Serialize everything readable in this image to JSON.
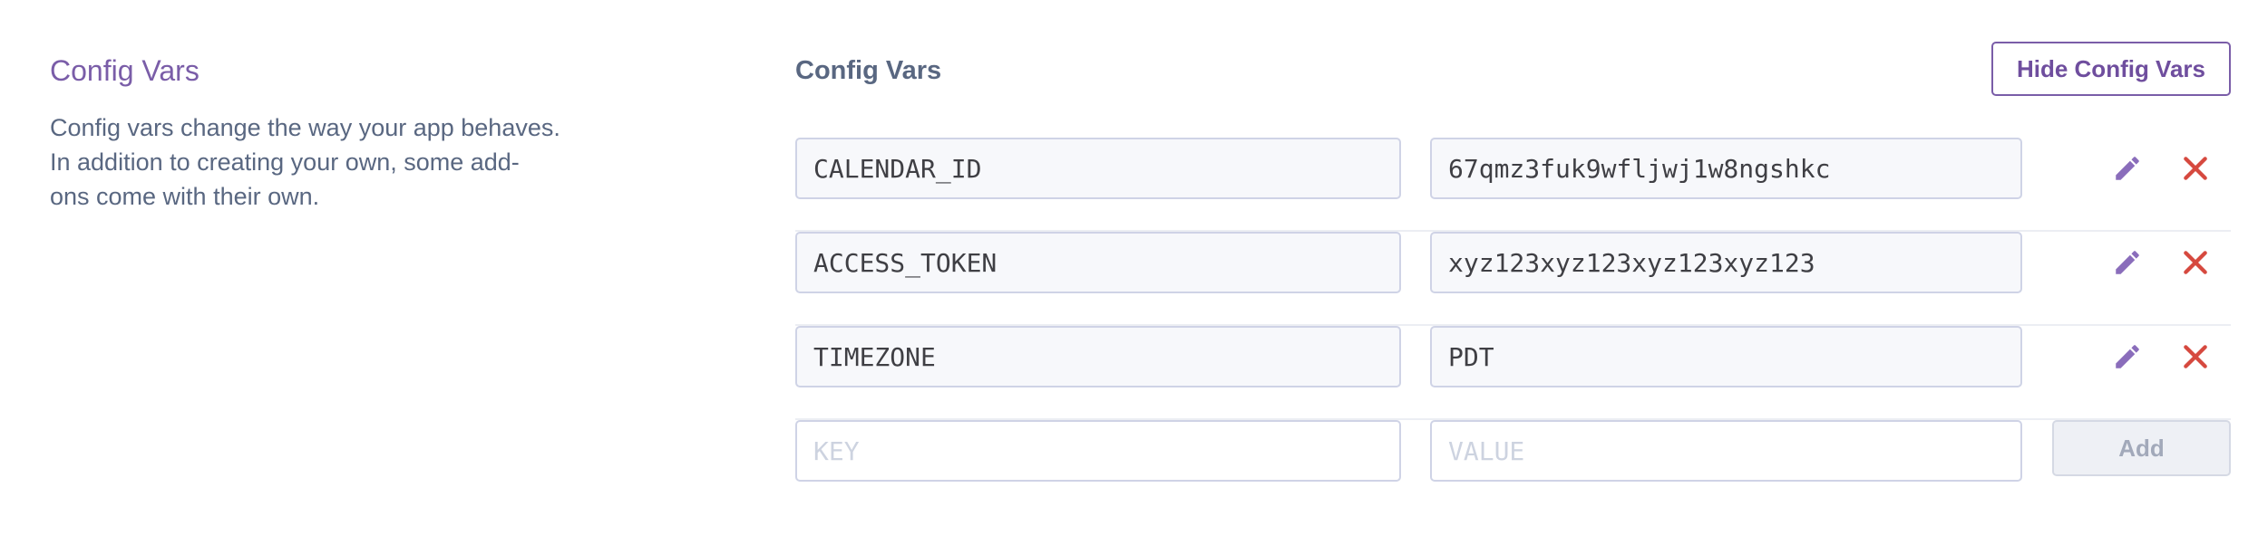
{
  "section": {
    "title": "Config Vars",
    "description_lines": [
      "Config vars change the way your app behaves.",
      "In addition to creating your own, some add-",
      "ons come with their own."
    ]
  },
  "panel": {
    "title": "Config Vars",
    "hide_button_label": "Hide Config Vars"
  },
  "vars": [
    {
      "key": "CALENDAR_ID",
      "value": "67qmz3fuk9wfljwj1w8ngshkc"
    },
    {
      "key": "ACCESS_TOKEN",
      "value": "xyz123xyz123xyz123xyz123"
    },
    {
      "key": "TIMEZONE",
      "value": "PDT"
    }
  ],
  "new_var": {
    "key_placeholder": "KEY",
    "value_placeholder": "VALUE",
    "add_label": "Add"
  },
  "icons": {
    "edit": "pencil-icon",
    "delete": "x-icon"
  },
  "colors": {
    "accent": "#7a5da8",
    "text_muted": "#596781",
    "delete": "#d6493f",
    "edit": "#8a6dbb"
  }
}
